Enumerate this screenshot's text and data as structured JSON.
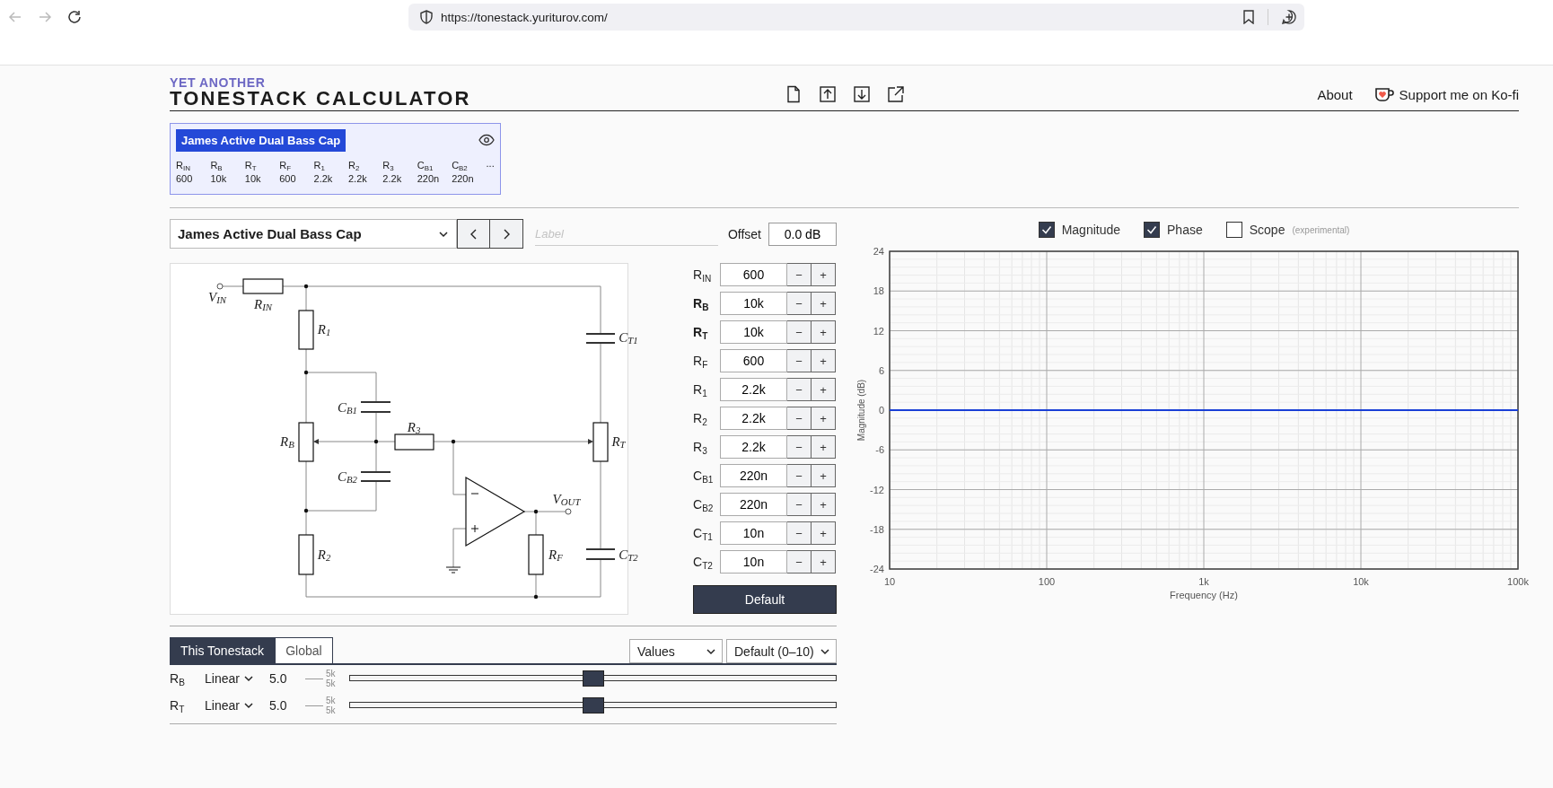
{
  "browser": {
    "url": "https://tonestack.yuriturov.com/"
  },
  "header": {
    "logo_top": "YET ANOTHER",
    "logo_main": "TONESTACK CALCULATOR",
    "links": [
      {
        "label": "About",
        "kind": "text"
      },
      {
        "label": "Support me on Ko-fi",
        "kind": "kofi"
      }
    ]
  },
  "presets": [
    {
      "title": "James Active Dual Bass Cap",
      "selected": true,
      "more": "...",
      "columns": [
        {
          "label": "R$_{IN}$",
          "value": "600"
        },
        {
          "label": "R$_{B}$",
          "value": "10k"
        },
        {
          "label": "R$_{T}$",
          "value": "10k"
        },
        {
          "label": "R$_{F}$",
          "value": "600"
        },
        {
          "label": "R$_{1}$",
          "value": "2.2k"
        },
        {
          "label": "R$_{2}$",
          "value": "2.2k"
        },
        {
          "label": "R$_{3}$",
          "value": "2.2k"
        },
        {
          "label": "C$_{B1}$",
          "value": "220n"
        },
        {
          "label": "C$_{B2}$",
          "value": "220n"
        }
      ]
    }
  ],
  "editor": {
    "preset": "James Active Dual Bass Cap",
    "label_placeholder": "Label",
    "offset_label": "Offset",
    "offset_value": "0.0 dB",
    "default_button": "Default",
    "schematic_labels": [
      {
        "text": "V$_{IN}$"
      },
      {
        "text": "R$_{IN}$"
      },
      {
        "text": "R$_{1}$"
      },
      {
        "text": "C$_{T1}$"
      },
      {
        "text": "C$_{B1}$"
      },
      {
        "text": "R$_{3}$"
      },
      {
        "text": "R$_{B}$"
      },
      {
        "text": "R$_{T}$"
      },
      {
        "text": "C$_{B2}$"
      },
      {
        "text": "V$_{OUT}$"
      },
      {
        "text": "R$_{2}$"
      },
      {
        "text": "R$_{F}$"
      },
      {
        "text": "C$_{T2}$"
      }
    ],
    "parts": [
      {
        "label": "R$_{IN}$",
        "kind": "part",
        "value": "600",
        "dec": "−",
        "inc": "+"
      },
      {
        "label": "R$_{B}$",
        "kind": "pot",
        "value": "10k",
        "dec": "−",
        "inc": "+"
      },
      {
        "label": "R$_{T}$",
        "kind": "pot",
        "value": "10k",
        "dec": "−",
        "inc": "+"
      },
      {
        "label": "R$_{F}$",
        "kind": "part",
        "value": "600",
        "dec": "−",
        "inc": "+"
      },
      {
        "label": "R$_{1}$",
        "kind": "part",
        "value": "2.2k",
        "dec": "−",
        "inc": "+"
      },
      {
        "label": "R$_{2}$",
        "kind": "part",
        "value": "2.2k",
        "dec": "−",
        "inc": "+"
      },
      {
        "label": "R$_{3}$",
        "kind": "part",
        "value": "2.2k",
        "dec": "−",
        "inc": "+"
      },
      {
        "label": "C$_{B1}$",
        "kind": "part",
        "value": "220n",
        "dec": "−",
        "inc": "+"
      },
      {
        "label": "C$_{B2}$",
        "kind": "part",
        "value": "220n",
        "dec": "−",
        "inc": "+"
      },
      {
        "label": "C$_{T1}$",
        "kind": "part",
        "value": "10n",
        "dec": "−",
        "inc": "+"
      },
      {
        "label": "C$_{T2}$",
        "kind": "part",
        "value": "10n",
        "dec": "−",
        "inc": "+"
      }
    ]
  },
  "controls": {
    "tabs": [
      {
        "label": "This Tonestack",
        "selected": true
      },
      {
        "label": "Global",
        "selected": false
      }
    ],
    "dropdowns": [
      {
        "value": "Values"
      },
      {
        "value": "Default (0–10)"
      }
    ],
    "sliders": [
      {
        "label": "R$_{B}$",
        "taper": "Linear",
        "reading": "5.0",
        "upper": "5k",
        "lower": "5k",
        "level": 0.5
      },
      {
        "label": "R$_{T}$",
        "taper": "Linear",
        "reading": "5.0",
        "upper": "5k",
        "lower": "5k",
        "level": 0.5
      }
    ]
  },
  "chart": {
    "toggles": [
      {
        "label": "Magnitude",
        "checked": true
      },
      {
        "label": "Phase",
        "checked": true
      },
      {
        "label": "Scope",
        "note": "(experimental)",
        "checked": false
      }
    ],
    "chart_data": {
      "type": "line",
      "xlabel": "Frequency (Hz)",
      "ylabel": "Magnitude (dB)",
      "categories": [
        "10",
        "100",
        "1k",
        "10k",
        "100k"
      ],
      "series": [
        {
          "color": "#1a3fd6",
          "values": [
            0,
            0,
            0,
            0,
            0
          ]
        }
      ],
      "ylim": [
        -24,
        24
      ],
      "grid": true,
      "yticks": [
        24,
        18,
        12,
        6,
        0,
        -6,
        -12,
        -18,
        -24
      ]
    }
  }
}
